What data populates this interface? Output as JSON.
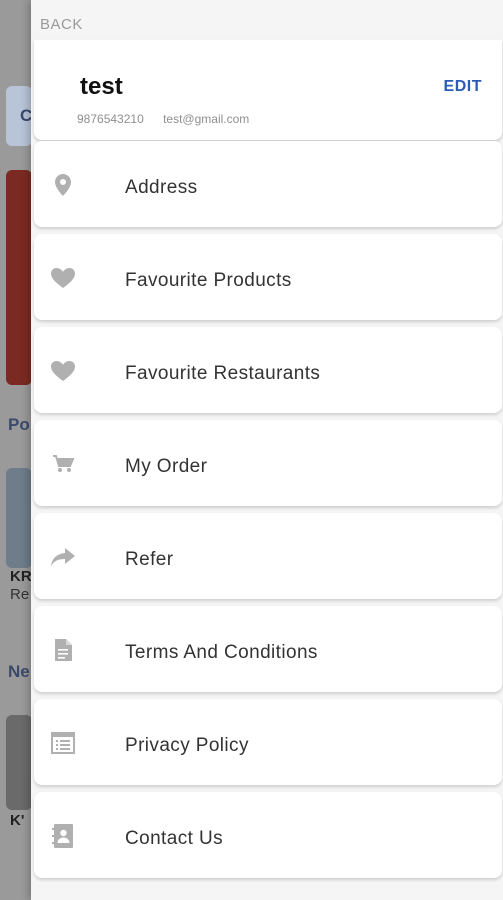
{
  "background": {
    "fragments": [
      "C",
      "Po",
      "KR",
      "Re",
      "Ne",
      "K'"
    ]
  },
  "drawer": {
    "back_label": "BACK",
    "profile": {
      "name": "test",
      "phone": "9876543210",
      "email": "test@gmail.com",
      "edit_label": "EDIT"
    },
    "menu": [
      {
        "label": "Address",
        "icon": "location-pin-icon"
      },
      {
        "label": "Favourite Products",
        "icon": "heart-icon"
      },
      {
        "label": "Favourite Restaurants",
        "icon": "heart-icon"
      },
      {
        "label": "My Order",
        "icon": "cart-icon"
      },
      {
        "label": "Refer",
        "icon": "share-arrow-icon"
      },
      {
        "label": "Terms And Conditions",
        "icon": "document-icon"
      },
      {
        "label": "Privacy Policy",
        "icon": "list-icon"
      },
      {
        "label": "Contact Us",
        "icon": "contact-book-icon"
      }
    ]
  },
  "colors": {
    "accent": "#2a5bb5",
    "icon": "#b0b0b0"
  }
}
